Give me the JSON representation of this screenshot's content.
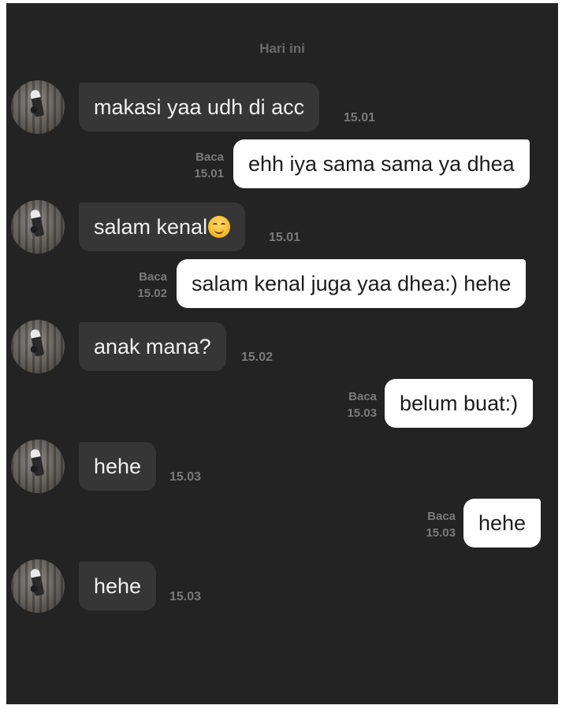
{
  "chat": {
    "day_separator": "Hari ini",
    "read_label": "Baca",
    "messages": [
      {
        "direction": "incoming",
        "text": "makasi yaa udh di acc",
        "time": "15.01"
      },
      {
        "direction": "outgoing",
        "text": "ehh iya sama sama ya dhea",
        "time": "15.01",
        "status": "Baca"
      },
      {
        "direction": "incoming",
        "text": "salam kenal",
        "emoji": "smiling-face-emoji",
        "time": "15.01"
      },
      {
        "direction": "outgoing",
        "text": "salam kenal juga yaa dhea:) hehe",
        "time": "15.02",
        "status": "Baca"
      },
      {
        "direction": "incoming",
        "text": "anak mana?",
        "time": "15.02"
      },
      {
        "direction": "outgoing",
        "text": "belum buat:)",
        "time": "15.03",
        "status": "Baca"
      },
      {
        "direction": "incoming",
        "text": "hehe",
        "time": "15.03"
      },
      {
        "direction": "outgoing",
        "text": "hehe",
        "time": "15.03",
        "status": "Baca"
      },
      {
        "direction": "incoming",
        "text": "hehe",
        "time": "15.03"
      }
    ]
  },
  "colors": {
    "background": "#232323",
    "incoming_bubble": "#363636",
    "outgoing_bubble": "#ffffff",
    "meta_text": "#7a7a7a"
  }
}
